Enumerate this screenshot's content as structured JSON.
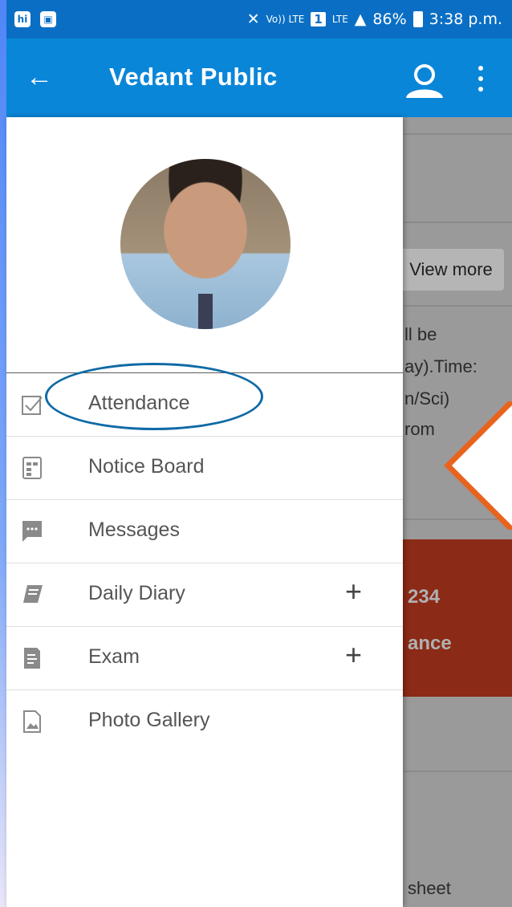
{
  "status_bar": {
    "left_icons": [
      "hi",
      "image-icon"
    ],
    "volte": "Vo)) LTE",
    "sim": "1",
    "network": "LTE",
    "battery": "86%",
    "time": "3:38 p.m."
  },
  "app_bar": {
    "title": "Vedant Public"
  },
  "background": {
    "view_more": "View more",
    "notice_lines": [
      "ll be",
      "ay).Time:",
      "n/Sci)",
      "rom"
    ],
    "card_number": "234",
    "card_label": "ance",
    "footer_text": "sheet",
    "card_color": "#8b2a16"
  },
  "drawer": {
    "items": [
      {
        "label": "Attendance",
        "icon": "checkbox-icon",
        "expandable": false
      },
      {
        "label": "Notice Board",
        "icon": "notice-board-icon",
        "expandable": false
      },
      {
        "label": "Messages",
        "icon": "chat-bubble-icon",
        "expandable": false
      },
      {
        "label": "Daily Diary",
        "icon": "book-icon",
        "expandable": true,
        "expand_symbol": "+"
      },
      {
        "label": "Exam",
        "icon": "exam-sheet-icon",
        "expandable": true,
        "expand_symbol": "+"
      },
      {
        "label": "Photo Gallery",
        "icon": "photo-file-icon",
        "expandable": false
      }
    ]
  },
  "colors": {
    "status_bar": "#0a6fc4",
    "app_bar": "#0a86d8",
    "highlight_ellipse": "#0f6aa6",
    "callout": "#e8641e"
  }
}
